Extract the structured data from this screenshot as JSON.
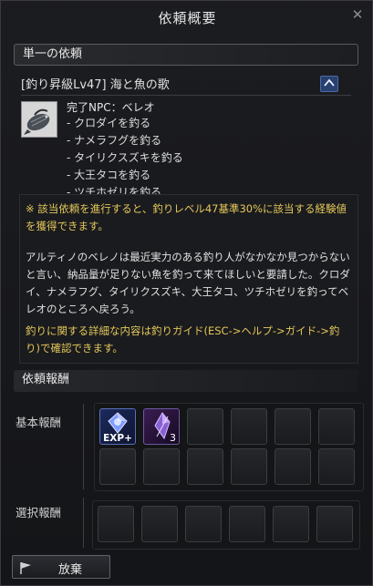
{
  "window": {
    "title": "依頼概要"
  },
  "section_single": "単一の依頼",
  "quest": {
    "title": "[釣り昇級Lv47] 海と魚の歌",
    "npc": "完了NPC：ベレオ",
    "tasks": [
      "- クロダイを釣る",
      "- ナメラフグを釣る",
      "- タイリクスズキを釣る",
      "- 大王タコを釣る",
      "- ツチホゼリを釣る"
    ]
  },
  "description": {
    "notice": "※ 該当依頼を進行すると、釣りレベル47基準30%に該当する経験値を獲得できます。",
    "story": "アルティノのベレノは最近実力のある釣り人がなかなか見つからないと言い、納品量が足りない魚を釣って来てほしいと要請した。クロダイ、ナメラフグ、タイリクスズキ、大王タコ、ツチホゼリを釣ってベレオのところへ戻ろう。",
    "guide": "釣りに関する詳細な内容は釣りガイド(ESC->ヘルプ->ガイド->釣り)で確認できます。"
  },
  "rewards": {
    "heading": "依頼報酬",
    "basic_label": "基本報酬",
    "select_label": "選択報酬",
    "exp_label": "EXP+",
    "item_count": "3"
  },
  "buttons": {
    "give_up": "放棄",
    "close_icon": "close-icon"
  },
  "colors": {
    "accent_gold": "#e3c75a",
    "up_button": "#28406e"
  }
}
